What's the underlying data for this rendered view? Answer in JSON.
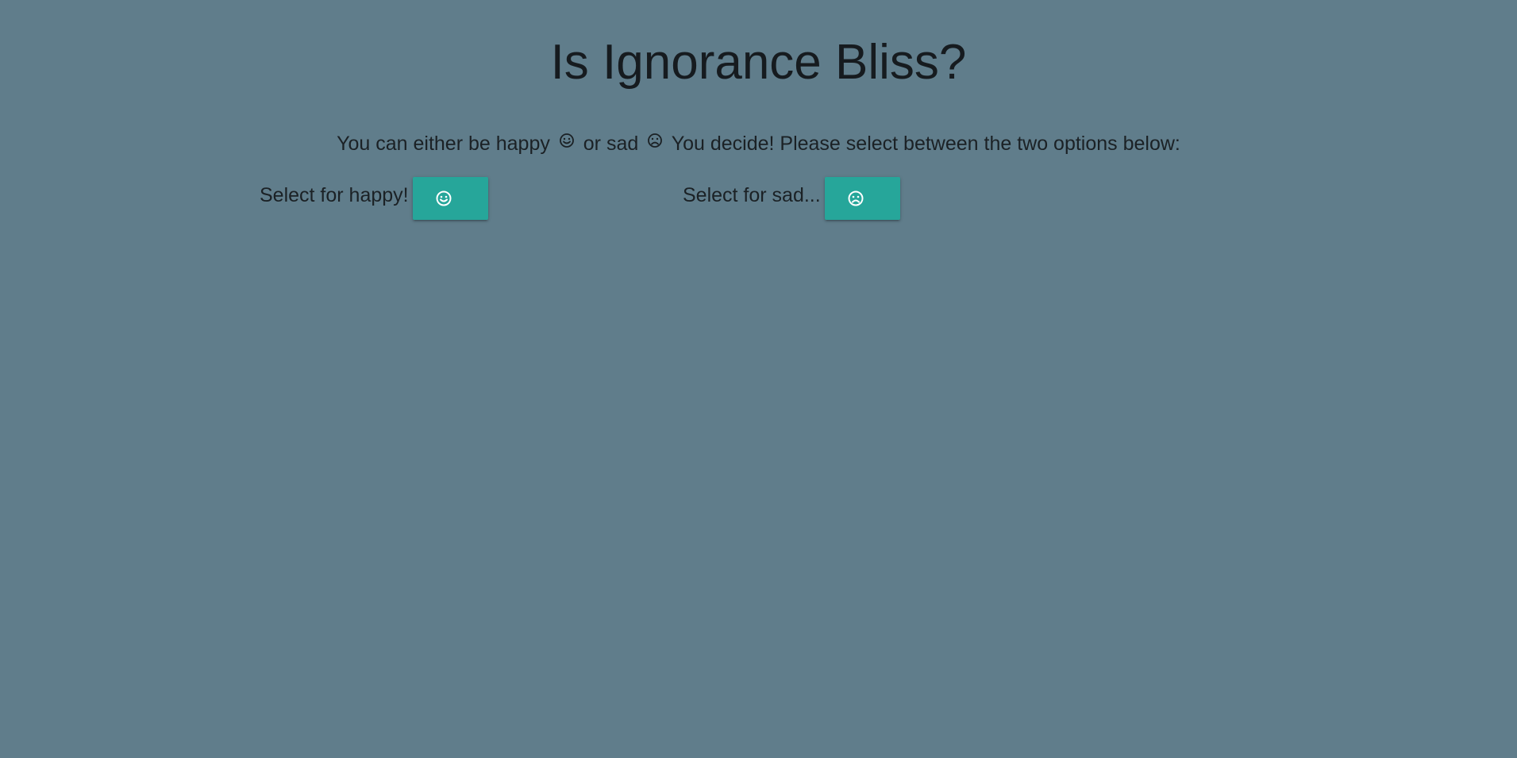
{
  "page": {
    "title": "Is Ignorance Bliss?",
    "intro": {
      "part1": "You can either be happy",
      "happy_icon": "smiley-face-icon",
      "part2": "or sad",
      "sad_icon": "frown-face-icon",
      "part3": "You decide! Please select between the two options below:"
    }
  },
  "options": {
    "happy": {
      "label": "Select for happy!",
      "button_icon": "smiley-face-icon"
    },
    "sad": {
      "label": "Select for sad...",
      "button_icon": "frown-face-icon"
    }
  },
  "colors": {
    "background": "#607d8b",
    "button": "#26a69a",
    "text": "#1b2125",
    "icon_on_button": "#ffffff"
  }
}
